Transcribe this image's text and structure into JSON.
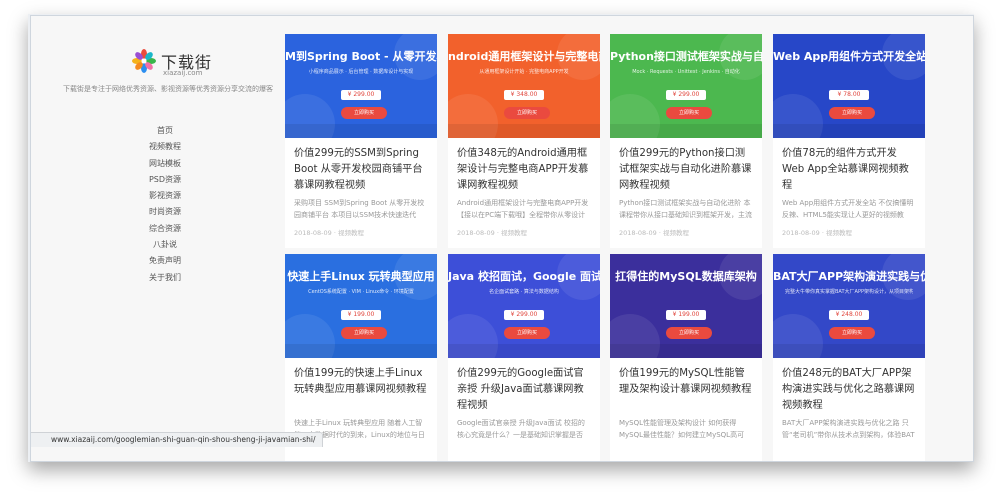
{
  "site": {
    "logo_cn": "下载街",
    "logo_en": "xiazaij.com",
    "tagline": "下载街是专注于网络优秀资源、影视资源等优秀资源分享交流的爆客"
  },
  "nav": [
    "首页",
    "视频教程",
    "网站模板",
    "PSD资源",
    "影视资源",
    "时尚资源",
    "综合资源",
    "八卦说",
    "免责声明",
    "关于我们"
  ],
  "colors": {
    "blue": "#2b63de",
    "orange": "#f2612c",
    "green": "#4cb84f",
    "navy": "#2747c8",
    "sky": "#2a6fe0",
    "indigo": "#3d4fd8",
    "purple": "#3b2f9c",
    "royal": "#3348c8"
  },
  "cards": [
    {
      "thumb_title": "M到Spring Boot - 从零开发校园商铺",
      "thumb_sub": "小程序商品展示 · 后台管理 · 数据库设计与实现",
      "thumb_price": "¥ 299.00",
      "thumb_btn": "立即购买",
      "title": "价值299元的SSM到Spring Boot 从零开发校园商铺平台慕课网教程视频",
      "desc": "采购项目 SSM到Spring Boot 从零开发校园商铺平台 本项目以SSM技术快速迭代",
      "meta": "2018-08-09 · 视频教程",
      "color": "#2b63de"
    },
    {
      "thumb_title": "ndroid通用框架设计与完整电商APP开",
      "thumb_sub": "从通用框架设计开始 · 完整电商APP开发",
      "thumb_price": "¥ 348.00",
      "thumb_btn": "立即购买",
      "title": "价值348元的Android通用框架设计与完整电商APP开发慕课网教程视频",
      "desc": "Android通用框架设计与完整电商APP开发【接以在PC端下载哦】全程带你从零设计",
      "meta": "2018-08-09 · 视频教程",
      "color": "#f2612c"
    },
    {
      "thumb_title": "Python接口测试框架实战与自动化进",
      "thumb_sub": "Mock · Requests · Unittest · Jenkins · 自动化",
      "thumb_price": "¥ 299.00",
      "thumb_btn": "立即购买",
      "title": "价值299元的Python接口测试框架实战与自动化进阶慕课网教程视频",
      "desc": "Python接口测试框架实战与自动化进阶 本课程带你从接口基础知识到框架开发，主流",
      "meta": "2018-08-09 · 视频教程",
      "color": "#4cb84f"
    },
    {
      "thumb_title": "Web App用组件方式开发全站",
      "thumb_sub": "",
      "thumb_price": "¥ 78.00",
      "thumb_btn": "立即购买",
      "title": "价值78元的组件方式开发 Web App全站慕课网视频教程",
      "desc": "Web App用组件方式开发全站 不仅搞懂明反辣、HTML5能实现让人更好的视频教",
      "meta": "2018-08-09 · 视频教程",
      "color": "#2747c8"
    },
    {
      "thumb_title": "快速上手Linux 玩转典型应用",
      "thumb_sub": "CentOS系统配置 · VIM · Linux命令 · 环境配置",
      "thumb_price": "¥ 199.00",
      "thumb_btn": "立即购买",
      "title": "价值199元的快速上手Linux 玩转典型应用慕课网视频教程",
      "desc": "快速上手Linux 玩转典型应用 随着人工智能、大数据时代的到来，Linux的地位与日",
      "meta": "",
      "color": "#2a6fe0"
    },
    {
      "thumb_title": "Java 校招面试，Google 面试官亲授",
      "thumb_sub": "名企面试套路 · 算法与数据结构",
      "thumb_price": "¥ 299.00",
      "thumb_btn": "立即购买",
      "title": "价值299元的Google面试官亲授 升级Java面试慕课网教程视频",
      "desc": "Google面试官亲授 升级Java面试 校招的核心究竟是什么？一是基础知识掌握是否",
      "meta": "",
      "color": "#3d4fd8"
    },
    {
      "thumb_title": "扛得住的MySQL数据库架构",
      "thumb_sub": "",
      "thumb_price": "¥ 199.00",
      "thumb_btn": "立即购买",
      "title": "价值199元的MySQL性能管理及架构设计慕课网视频教程",
      "desc": "MySQL性能管理及架构设计 如何获得MySQL最佳性能？如何建立MySQL高可",
      "meta": "",
      "color": "#3b2f9c"
    },
    {
      "thumb_title": "BAT大厂APP架构演进实践与优化之",
      "thumb_sub": "完整大牛带你真实掌握BAT大厂APP架构设计，从项目架构演变到优化",
      "thumb_price": "¥ 248.00",
      "thumb_btn": "立即购买",
      "title": "价值248元的BAT大厂APP架构演进实践与优化之路慕课网视频教程",
      "desc": "BAT大厂APP架构演进实践与优化之路 只管“老司机”带你从技术点到架构，体验BAT",
      "meta": "",
      "color": "#3348c8"
    }
  ],
  "statusbar": "www.xiazaij.com/googlemian-shi-guan-qin-shou-sheng-ji-javamian-shi/"
}
